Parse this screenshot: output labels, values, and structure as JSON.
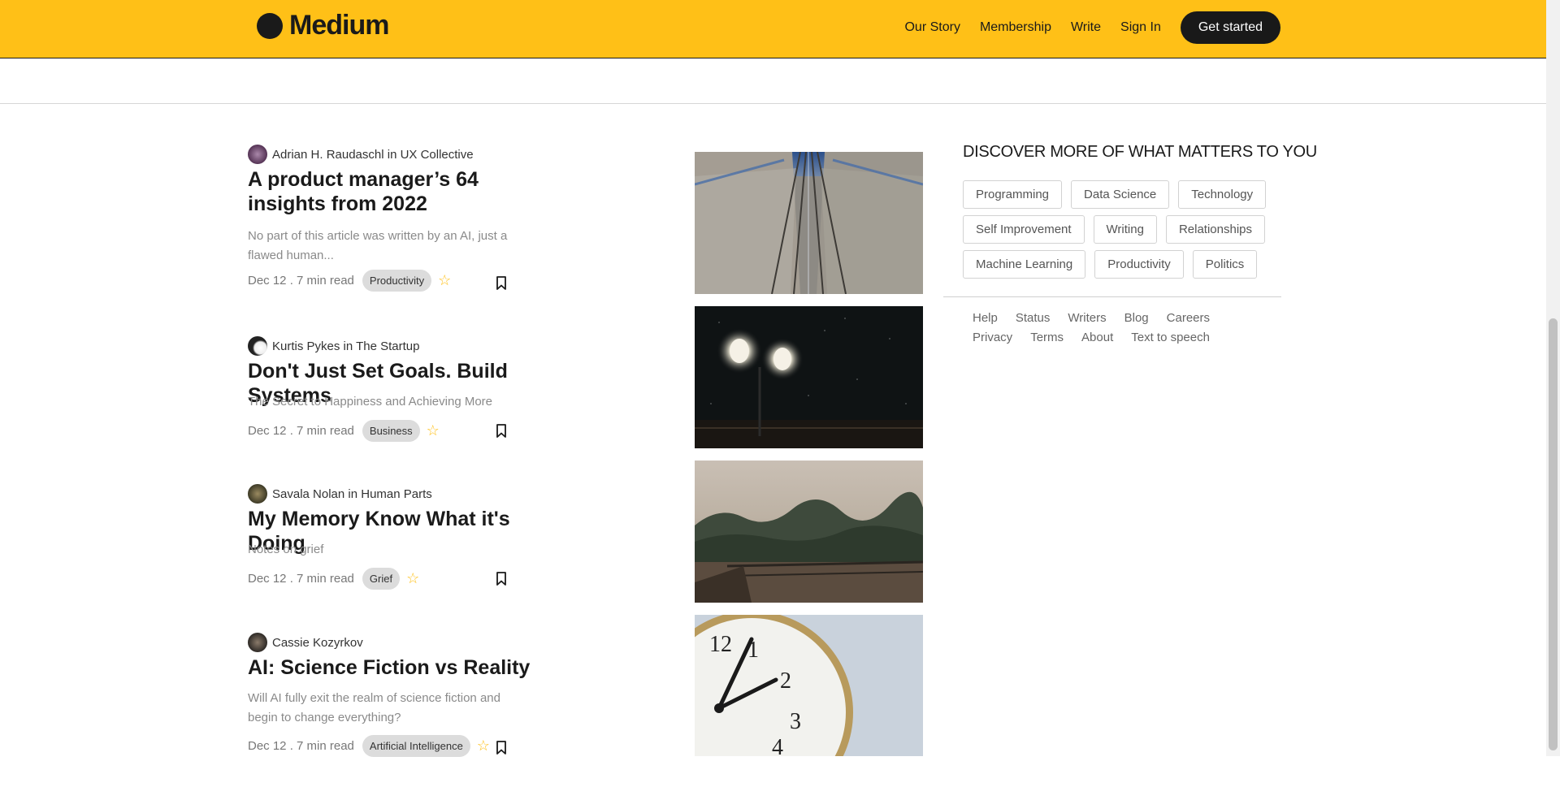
{
  "header": {
    "logo_text": "Medium",
    "nav": [
      "Our Story",
      "Membership",
      "Write",
      "Sign In"
    ],
    "cta": "Get started",
    "bg_color": "#ffc017"
  },
  "articles": [
    {
      "author": "Adrian H. Raudaschl in UX Collective",
      "title": "A product manager’s 64 insights from 2022",
      "desc": "No part of this article was written by an AI, just a flawed human...",
      "date": "Dec 12 . 7 min read",
      "tag": "Productivity"
    },
    {
      "author": "Kurtis Pykes in The Startup",
      "title": "Don't Just Set Goals. Build Systems",
      "desc": "The Secret to Happiness and Achieving More",
      "date": "Dec 12 . 7 min read",
      "tag": "Business"
    },
    {
      "author": "Savala Nolan in Human Parts",
      "title": "My Memory Know What it's Doing",
      "desc": "Notes on grief",
      "date": "Dec 12 . 7 min read",
      "tag": "Grief"
    },
    {
      "author": "Cassie Kozyrkov",
      "title": "AI: Science Fiction vs Reality",
      "desc": "Will AI fully exit the realm of science fiction and begin to change everything?",
      "date": "Dec 12 . 7 min read",
      "tag": "Artificial Intelligence"
    }
  ],
  "sidebar": {
    "title": "DISCOVER MORE OF WHAT MATTERS TO YOU",
    "topics": [
      "Programming",
      "Data Science",
      "Technology",
      "Self Improvement",
      "Writing",
      "Relationships",
      "Machine Learning",
      "Productivity",
      "Politics"
    ],
    "footer_links": [
      "Help",
      "Status",
      "Writers",
      "Blog",
      "Careers",
      "Privacy",
      "Terms",
      "About",
      "Text to speech"
    ]
  },
  "icons": {
    "star": "star-icon",
    "bookmark": "bookmark-icon",
    "logo": "medium-logo-icon"
  }
}
